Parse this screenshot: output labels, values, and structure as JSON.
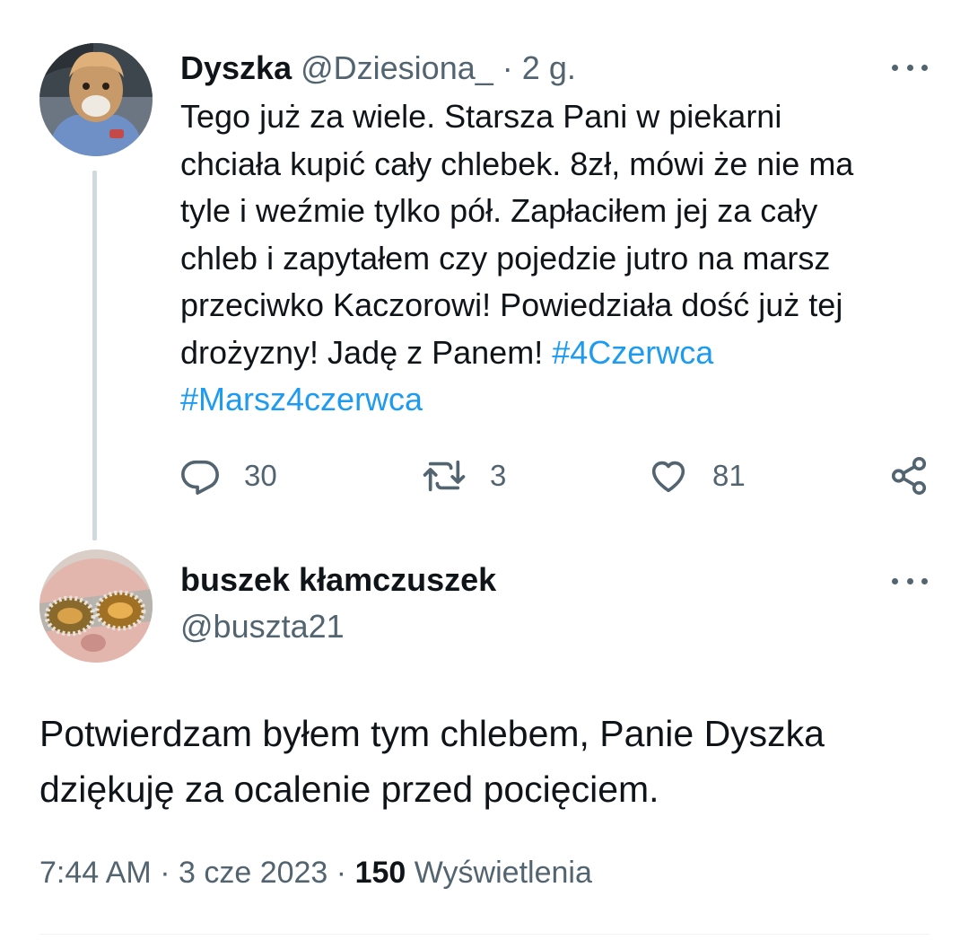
{
  "tweet": {
    "author_name": "Dyszka",
    "author_handle": "@Dziesiona_",
    "separator": "·",
    "time_ago": "2 g.",
    "text_lines": [
      "Tego już za wiele. Starsza Pani w piekarni",
      "chciała kupić cały chlebek. 8zł, mówi że nie ma",
      "tyle i weźmie tylko pół. Zapłaciłem jej za cały",
      "chleb i zapytałem czy pojedzie jutro na marsz",
      "przeciwko Kaczorowi! Powiedziała dość już tej",
      "drożyzny! Jadę z Panem!"
    ],
    "hashtags": [
      "#4Czerwca",
      "#Marsz4czerwca"
    ],
    "reply_count": "30",
    "retweet_count": "3",
    "like_count": "81",
    "icons": {
      "reply": "reply-icon",
      "retweet": "retweet-icon",
      "like": "heart-icon",
      "share": "share-icon",
      "more": "more-icon"
    }
  },
  "reply": {
    "author_name": "buszek kłamczuszek",
    "author_handle": "@buszta21",
    "text_lines": [
      "Potwierdzam byłem tym chlebem, Panie Dyszka",
      "dziękuję za ocalenie przed pocięciem."
    ],
    "time": "7:44 AM",
    "separator": "·",
    "date": "3 cze 2023",
    "views_count": "150",
    "views_label": "Wyświetlenia"
  },
  "colors": {
    "text": "#0f1419",
    "secondary": "#536471",
    "accent": "#1d9bf0",
    "thread_line": "#cfd9de"
  }
}
